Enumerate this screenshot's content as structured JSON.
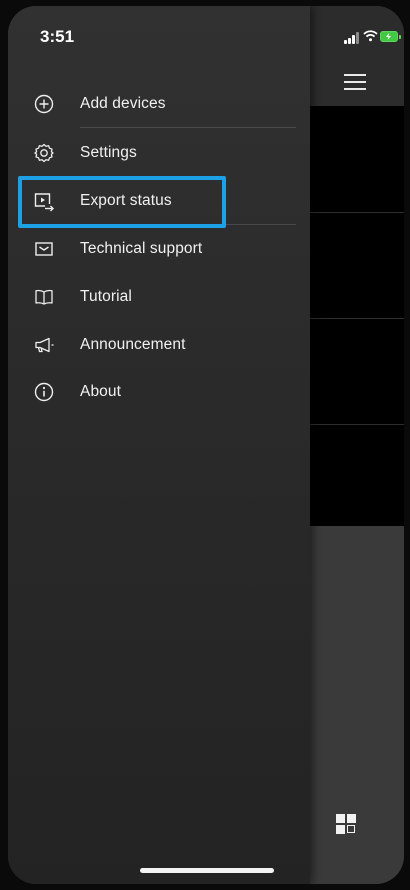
{
  "status_bar": {
    "time": "3:51",
    "signal_icon": "cellular-signal-icon",
    "wifi_icon": "wifi-icon",
    "battery_icon": "battery-charging-icon",
    "battery_color": "#43c843"
  },
  "drawer": {
    "items": [
      {
        "label": "Add devices",
        "icon": "plus-circle-icon"
      },
      {
        "label": "Settings",
        "icon": "gear-icon"
      },
      {
        "label": "Export status",
        "icon": "export-video-icon"
      },
      {
        "label": "Technical support",
        "icon": "envelope-icon"
      },
      {
        "label": "Tutorial",
        "icon": "book-icon"
      },
      {
        "label": "Announcement",
        "icon": "megaphone-icon"
      },
      {
        "label": "About",
        "icon": "info-circle-icon"
      }
    ],
    "highlighted_item": "Export status",
    "highlight_color": "#1da1e6"
  },
  "app": {
    "menu_icon": "hamburger-menu-icon",
    "layout_icon": "grid-layout-icon"
  }
}
